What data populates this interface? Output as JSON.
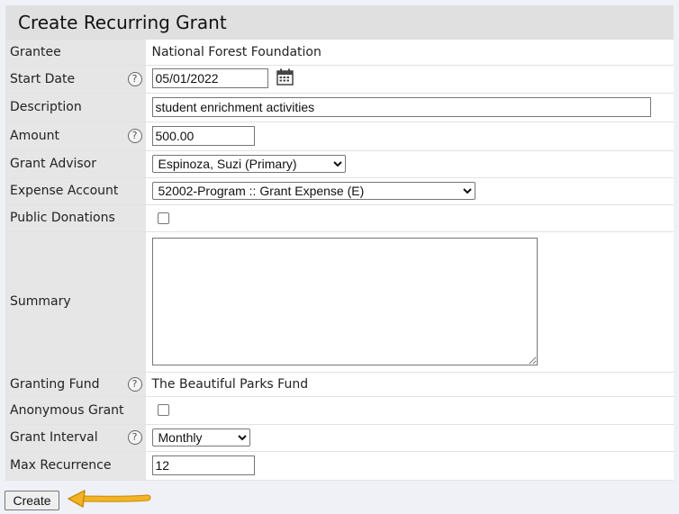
{
  "page_title": "Create Recurring Grant",
  "help_glyph": "?",
  "fields": {
    "grantee": {
      "label": "Grantee",
      "value": "National Forest Foundation"
    },
    "start_date": {
      "label": "Start Date",
      "value": "05/01/2022"
    },
    "description": {
      "label": "Description",
      "value": "student enrichment activities"
    },
    "amount": {
      "label": "Amount",
      "value": "500.00"
    },
    "grant_advisor": {
      "label": "Grant Advisor",
      "selected": "Espinoza, Suzi (Primary)"
    },
    "expense_account": {
      "label": "Expense Account",
      "selected": "52002-Program :: Grant Expense (E)"
    },
    "public_donations": {
      "label": "Public Donations",
      "checked": false
    },
    "summary": {
      "label": "Summary",
      "value": ""
    },
    "granting_fund": {
      "label": "Granting Fund",
      "value": "The Beautiful Parks Fund"
    },
    "anonymous_grant": {
      "label": "Anonymous Grant",
      "checked": false
    },
    "grant_interval": {
      "label": "Grant Interval",
      "selected": "Monthly"
    },
    "max_recurrence": {
      "label": "Max Recurrence",
      "value": "12"
    }
  },
  "actions": {
    "create_label": "Create"
  },
  "colors": {
    "header_bg": "#e0e0e0",
    "label_bg": "#e6e6e6",
    "page_bg": "#f0f1f6",
    "arrow": "#f2b424"
  },
  "icons": {
    "calendar": "calendar-icon",
    "help": "help-icon",
    "pointer": "arrow-left-icon"
  }
}
